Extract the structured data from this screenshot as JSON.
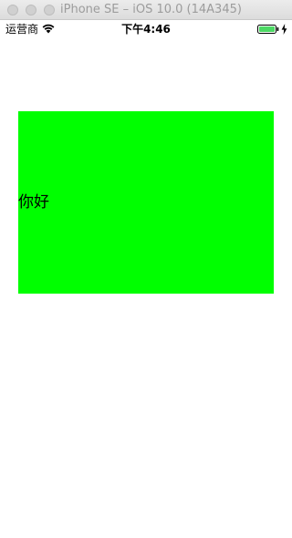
{
  "window": {
    "title": "iPhone SE – iOS 10.0 (14A345)"
  },
  "statusbar": {
    "carrier": "运营商",
    "time": "下午4:46",
    "wifi_icon": "wifi-icon",
    "battery_icon": "battery-icon",
    "charging_icon": "bolt-icon",
    "battery_color": "#4cd964"
  },
  "content": {
    "box_color": "#00ff00",
    "label": "你好"
  }
}
